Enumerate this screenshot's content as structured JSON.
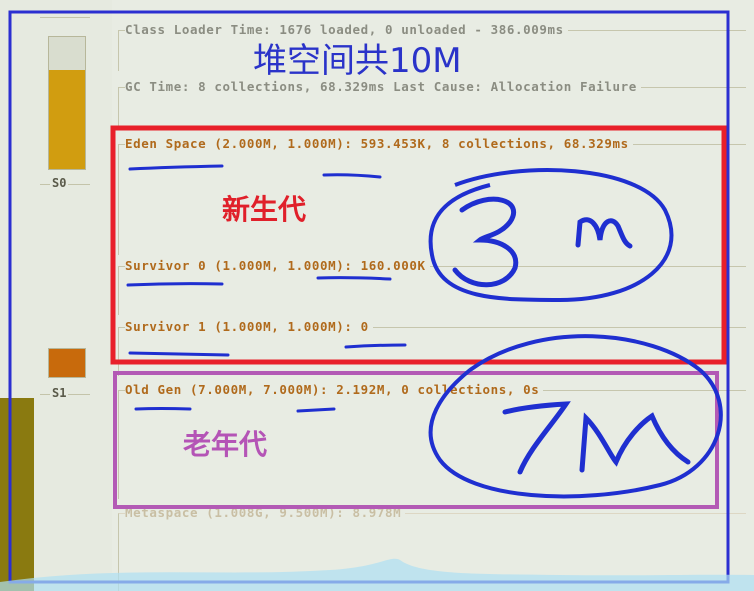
{
  "rows": [
    {
      "text": "Class Loader Time: 1676 loaded, 0 unloaded - 386.009ms"
    },
    {
      "text": "GC Time: 8 collections, 68.329ms Last Cause: Allocation Failure"
    },
    {
      "text": "Eden Space (2.000M, 1.000M): 593.453K, 8 collections, 68.329ms"
    },
    {
      "text": "Survivor 0 (1.000M, 1.000M): 160.000K"
    },
    {
      "text": "Survivor 1 (1.000M, 1.000M): 0"
    },
    {
      "text": "Old Gen (7.000M, 7.000M): 2.192M, 0 collections, 0s"
    },
    {
      "text": "Metaspace (1.008G, 9.500M): 8.978M"
    }
  ],
  "gauges": [
    {
      "label": "S0",
      "fill_percent": 75,
      "color": "#d19d10"
    },
    {
      "label": "S1",
      "fill_percent": 100,
      "color": "#c86a0c"
    }
  ],
  "annotations": {
    "heap_total": "堆空间共10M",
    "young_gen": "新生代",
    "old_gen": "老年代",
    "young_size": "3M",
    "old_size": "7M"
  },
  "colors": {
    "heap_box": "#2b2fd1",
    "young_box": "#e8202a",
    "old_box": "#b35ab5",
    "ink": "#1f2fd0",
    "label_orange": "#b06a1c"
  }
}
